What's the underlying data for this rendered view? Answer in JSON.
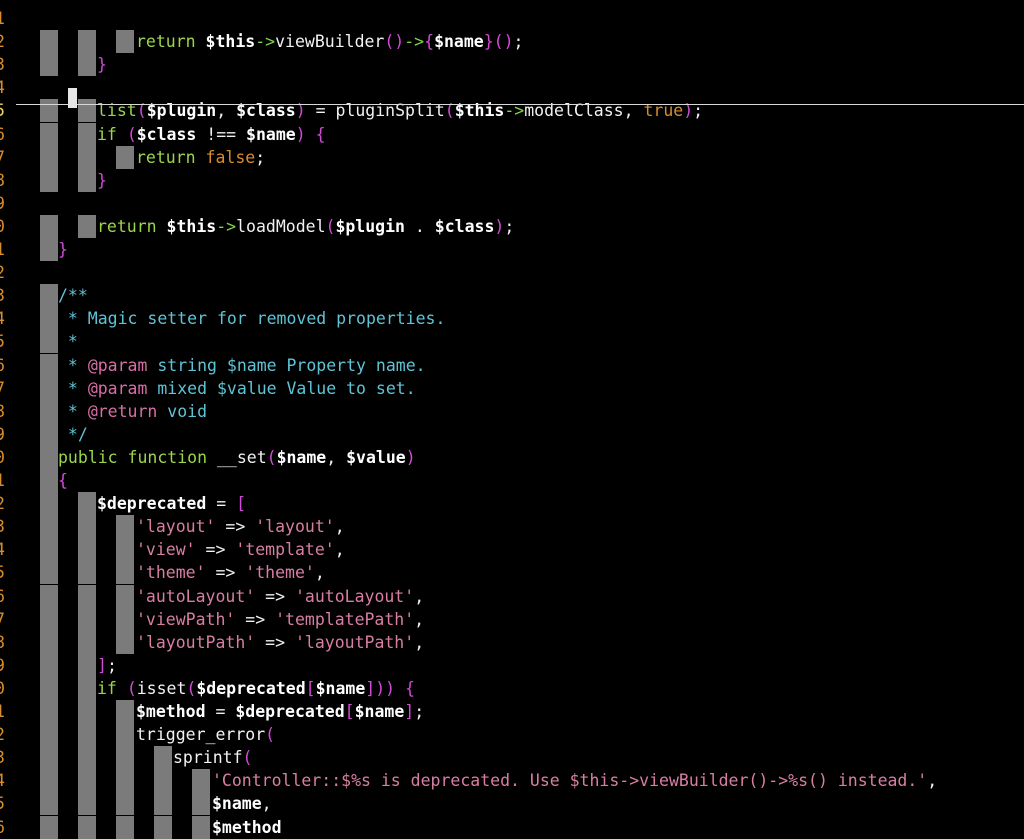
{
  "editor": {
    "line_numbers": [
      "1",
      "2",
      "3",
      "4",
      "5",
      "6",
      "7",
      "8",
      "9",
      "0",
      "1",
      "2",
      "3",
      "4",
      "5",
      "6",
      "7",
      "8",
      "9",
      "0",
      "1",
      "2",
      "3",
      "4",
      "5",
      "6",
      "7",
      "8",
      "9",
      "0",
      "1",
      "2",
      "3",
      "4",
      "5",
      "6"
    ],
    "current_line_index": 4,
    "colors": {
      "background": "#000000",
      "line_number": "#d98c2a",
      "current_line_number": "#f2d65c",
      "indent_guide": "#7b7b7b",
      "variable": "#ffffff",
      "arrow_operator": "#7fd54d",
      "punctuation": "#d24bd6",
      "keyword": "#9bd64a",
      "boolean": "#d98c2a",
      "string": "#d97ea3",
      "comment": "#5fc4d6",
      "doc_tag": "#d96ea6"
    },
    "lines": [
      {
        "tokens": []
      },
      {
        "tokens": [
          {
            "t": "return ",
            "c": "tk-kw"
          },
          {
            "t": "$this",
            "c": "tk-var"
          },
          {
            "t": "->",
            "c": "tk-arrow"
          },
          {
            "t": "viewBuilder",
            "c": "tk-fn"
          },
          {
            "t": "()",
            "c": "tk-punc"
          },
          {
            "t": "->",
            "c": "tk-arrow"
          },
          {
            "t": "{",
            "c": "tk-punc"
          },
          {
            "t": "$name",
            "c": "tk-var"
          },
          {
            "t": "}",
            "c": "tk-punc"
          },
          {
            "t": "()",
            "c": "tk-punc"
          },
          {
            "t": ";",
            "c": "tk-text"
          }
        ]
      },
      {
        "tokens": [
          {
            "t": "}",
            "c": "tk-punc"
          }
        ]
      },
      {
        "tokens": []
      },
      {
        "tokens": [
          {
            "t": "list",
            "c": "tk-kw"
          },
          {
            "t": "(",
            "c": "tk-punc"
          },
          {
            "t": "$plugin",
            "c": "tk-var"
          },
          {
            "t": ", ",
            "c": "tk-text"
          },
          {
            "t": "$class",
            "c": "tk-var"
          },
          {
            "t": ")",
            "c": "tk-punc"
          },
          {
            "t": " = ",
            "c": "tk-text"
          },
          {
            "t": "pluginSplit",
            "c": "tk-fn"
          },
          {
            "t": "(",
            "c": "tk-punc"
          },
          {
            "t": "$this",
            "c": "tk-var"
          },
          {
            "t": "->",
            "c": "tk-arrow"
          },
          {
            "t": "modelClass",
            "c": "tk-fn"
          },
          {
            "t": ", ",
            "c": "tk-text"
          },
          {
            "t": "true",
            "c": "tk-bool"
          },
          {
            "t": ")",
            "c": "tk-punc"
          },
          {
            "t": ";",
            "c": "tk-text"
          }
        ]
      },
      {
        "tokens": [
          {
            "t": "if ",
            "c": "tk-kw"
          },
          {
            "t": "(",
            "c": "tk-punc"
          },
          {
            "t": "$class",
            "c": "tk-var"
          },
          {
            "t": " !== ",
            "c": "tk-text"
          },
          {
            "t": "$name",
            "c": "tk-var"
          },
          {
            "t": ")",
            "c": "tk-punc"
          },
          {
            "t": " ",
            "c": "tk-text"
          },
          {
            "t": "{",
            "c": "tk-punc"
          }
        ]
      },
      {
        "tokens": [
          {
            "t": "return ",
            "c": "tk-kw"
          },
          {
            "t": "false",
            "c": "tk-bool"
          },
          {
            "t": ";",
            "c": "tk-text"
          }
        ]
      },
      {
        "tokens": [
          {
            "t": "}",
            "c": "tk-punc"
          }
        ]
      },
      {
        "tokens": []
      },
      {
        "tokens": [
          {
            "t": "return ",
            "c": "tk-kw"
          },
          {
            "t": "$this",
            "c": "tk-var"
          },
          {
            "t": "->",
            "c": "tk-arrow"
          },
          {
            "t": "loadModel",
            "c": "tk-fn"
          },
          {
            "t": "(",
            "c": "tk-punc"
          },
          {
            "t": "$plugin",
            "c": "tk-var"
          },
          {
            "t": " . ",
            "c": "tk-text"
          },
          {
            "t": "$class",
            "c": "tk-var"
          },
          {
            "t": ")",
            "c": "tk-punc"
          },
          {
            "t": ";",
            "c": "tk-text"
          }
        ]
      },
      {
        "tokens": [
          {
            "t": "}",
            "c": "tk-punc"
          }
        ]
      },
      {
        "tokens": []
      },
      {
        "tokens": [
          {
            "t": "/**",
            "c": "tk-comment"
          }
        ]
      },
      {
        "tokens": [
          {
            "t": " * Magic setter for removed properties.",
            "c": "tk-comment"
          }
        ]
      },
      {
        "tokens": [
          {
            "t": " *",
            "c": "tk-comment"
          }
        ]
      },
      {
        "tokens": [
          {
            "t": " * ",
            "c": "tk-comment"
          },
          {
            "t": "@param",
            "c": "tk-tag"
          },
          {
            "t": " string $name Property name.",
            "c": "tk-comment"
          }
        ]
      },
      {
        "tokens": [
          {
            "t": " * ",
            "c": "tk-comment"
          },
          {
            "t": "@param",
            "c": "tk-tag"
          },
          {
            "t": " mixed $value Value to set.",
            "c": "tk-comment"
          }
        ]
      },
      {
        "tokens": [
          {
            "t": " * ",
            "c": "tk-comment"
          },
          {
            "t": "@return",
            "c": "tk-tag"
          },
          {
            "t": " void",
            "c": "tk-comment"
          }
        ]
      },
      {
        "tokens": [
          {
            "t": " */",
            "c": "tk-comment"
          }
        ]
      },
      {
        "tokens": [
          {
            "t": "public function ",
            "c": "tk-kw"
          },
          {
            "t": "__set",
            "c": "tk-fn"
          },
          {
            "t": "(",
            "c": "tk-punc"
          },
          {
            "t": "$name",
            "c": "tk-var"
          },
          {
            "t": ", ",
            "c": "tk-text"
          },
          {
            "t": "$value",
            "c": "tk-var"
          },
          {
            "t": ")",
            "c": "tk-punc"
          }
        ]
      },
      {
        "tokens": [
          {
            "t": "{",
            "c": "tk-punc"
          }
        ]
      },
      {
        "tokens": [
          {
            "t": "$deprecated",
            "c": "tk-var"
          },
          {
            "t": " = ",
            "c": "tk-text"
          },
          {
            "t": "[",
            "c": "tk-punc"
          }
        ]
      },
      {
        "tokens": [
          {
            "t": "'layout'",
            "c": "tk-str"
          },
          {
            "t": " => ",
            "c": "tk-text"
          },
          {
            "t": "'layout'",
            "c": "tk-str"
          },
          {
            "t": ",",
            "c": "tk-text"
          }
        ]
      },
      {
        "tokens": [
          {
            "t": "'view'",
            "c": "tk-str"
          },
          {
            "t": " => ",
            "c": "tk-text"
          },
          {
            "t": "'template'",
            "c": "tk-str"
          },
          {
            "t": ",",
            "c": "tk-text"
          }
        ]
      },
      {
        "tokens": [
          {
            "t": "'theme'",
            "c": "tk-str"
          },
          {
            "t": " => ",
            "c": "tk-text"
          },
          {
            "t": "'theme'",
            "c": "tk-str"
          },
          {
            "t": ",",
            "c": "tk-text"
          }
        ]
      },
      {
        "tokens": [
          {
            "t": "'autoLayout'",
            "c": "tk-str"
          },
          {
            "t": " => ",
            "c": "tk-text"
          },
          {
            "t": "'autoLayout'",
            "c": "tk-str"
          },
          {
            "t": ",",
            "c": "tk-text"
          }
        ]
      },
      {
        "tokens": [
          {
            "t": "'viewPath'",
            "c": "tk-str"
          },
          {
            "t": " => ",
            "c": "tk-text"
          },
          {
            "t": "'templatePath'",
            "c": "tk-str"
          },
          {
            "t": ",",
            "c": "tk-text"
          }
        ]
      },
      {
        "tokens": [
          {
            "t": "'layoutPath'",
            "c": "tk-str"
          },
          {
            "t": " => ",
            "c": "tk-text"
          },
          {
            "t": "'layoutPath'",
            "c": "tk-str"
          },
          {
            "t": ",",
            "c": "tk-text"
          }
        ]
      },
      {
        "tokens": [
          {
            "t": "]",
            "c": "tk-punc"
          },
          {
            "t": ";",
            "c": "tk-text"
          }
        ]
      },
      {
        "tokens": [
          {
            "t": "if ",
            "c": "tk-kw"
          },
          {
            "t": "(",
            "c": "tk-punc"
          },
          {
            "t": "isset",
            "c": "tk-fn"
          },
          {
            "t": "(",
            "c": "tk-punc"
          },
          {
            "t": "$deprecated",
            "c": "tk-var"
          },
          {
            "t": "[",
            "c": "tk-punc"
          },
          {
            "t": "$name",
            "c": "tk-var"
          },
          {
            "t": "]",
            "c": "tk-punc"
          },
          {
            "t": "))",
            "c": "tk-punc"
          },
          {
            "t": " ",
            "c": "tk-text"
          },
          {
            "t": "{",
            "c": "tk-punc"
          }
        ]
      },
      {
        "tokens": [
          {
            "t": "$method",
            "c": "tk-var"
          },
          {
            "t": " = ",
            "c": "tk-text"
          },
          {
            "t": "$deprecated",
            "c": "tk-var"
          },
          {
            "t": "[",
            "c": "tk-punc"
          },
          {
            "t": "$name",
            "c": "tk-var"
          },
          {
            "t": "]",
            "c": "tk-punc"
          },
          {
            "t": ";",
            "c": "tk-text"
          }
        ]
      },
      {
        "tokens": [
          {
            "t": "trigger_error",
            "c": "tk-fn"
          },
          {
            "t": "(",
            "c": "tk-punc"
          }
        ]
      },
      {
        "tokens": [
          {
            "t": "sprintf",
            "c": "tk-fn"
          },
          {
            "t": "(",
            "c": "tk-punc"
          }
        ]
      },
      {
        "tokens": [
          {
            "t": "'Controller::$%s is deprecated. Use $this->viewBuilder()->%s() instead.'",
            "c": "tk-str"
          },
          {
            "t": ",",
            "c": "tk-text"
          }
        ]
      },
      {
        "tokens": [
          {
            "t": "$name",
            "c": "tk-var"
          },
          {
            "t": ",",
            "c": "tk-text"
          }
        ]
      },
      {
        "tokens": [
          {
            "t": "$method",
            "c": "tk-var"
          }
        ]
      }
    ]
  }
}
